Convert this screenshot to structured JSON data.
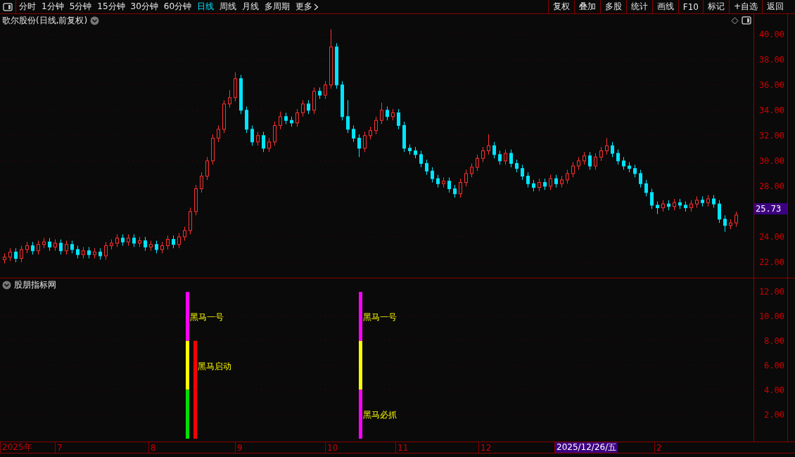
{
  "toolbar": {
    "periods": [
      {
        "label": "分时",
        "selected": false
      },
      {
        "label": "1分钟",
        "selected": false
      },
      {
        "label": "5分钟",
        "selected": false
      },
      {
        "label": "15分钟",
        "selected": false
      },
      {
        "label": "30分钟",
        "selected": false
      },
      {
        "label": "60分钟",
        "selected": false
      },
      {
        "label": "日线",
        "selected": true
      },
      {
        "label": "周线",
        "selected": false
      },
      {
        "label": "月线",
        "selected": false
      },
      {
        "label": "多周期",
        "selected": false
      }
    ],
    "more": "更多",
    "actions": [
      "复权",
      "叠加",
      "多股",
      "统计",
      "画线",
      "F10",
      "标记",
      "+自选",
      "返回"
    ]
  },
  "main_chart": {
    "title": "歌尔股份(日线,前复权)",
    "price_tag": "25.73",
    "chart_data": {
      "type": "candlestick",
      "ylim": [
        7.7,
        41.8
      ],
      "grid": true,
      "yticks": [
        {
          "value": 40,
          "label": "40.00"
        },
        {
          "value": 38,
          "label": "38.00"
        },
        {
          "value": 36,
          "label": "36.00"
        },
        {
          "value": 34,
          "label": "34.00"
        },
        {
          "value": 32,
          "label": "32.00"
        },
        {
          "value": 30,
          "label": "30.00"
        },
        {
          "value": 28,
          "label": "28.00"
        },
        {
          "value": 24,
          "label": "24.00"
        },
        {
          "value": 22,
          "label": "22.00"
        }
      ],
      "ohlc": [
        [
          22.2,
          22.7,
          21.9,
          22.4
        ],
        [
          22.4,
          23.1,
          22.1,
          22.8
        ],
        [
          22.8,
          23.1,
          22.0,
          22.3
        ],
        [
          22.3,
          23.3,
          22.0,
          23.0
        ],
        [
          23.0,
          23.6,
          22.7,
          23.3
        ],
        [
          23.3,
          23.6,
          22.6,
          22.9
        ],
        [
          22.9,
          23.7,
          22.6,
          23.4
        ],
        [
          23.4,
          23.9,
          23.1,
          23.6
        ],
        [
          23.6,
          23.9,
          22.9,
          23.2
        ],
        [
          23.2,
          23.8,
          22.9,
          23.5
        ],
        [
          23.5,
          23.8,
          22.6,
          22.9
        ],
        [
          22.9,
          23.7,
          22.6,
          23.4
        ],
        [
          23.4,
          23.7,
          22.7,
          23.0
        ],
        [
          23.0,
          23.3,
          22.3,
          22.6
        ],
        [
          22.6,
          23.2,
          22.3,
          22.9
        ],
        [
          22.9,
          23.2,
          22.3,
          22.6
        ],
        [
          22.6,
          23.1,
          22.3,
          22.8
        ],
        [
          22.8,
          23.1,
          22.2,
          22.5
        ],
        [
          22.5,
          23.6,
          22.2,
          23.3
        ],
        [
          23.3,
          23.8,
          23.0,
          23.5
        ],
        [
          23.5,
          24.2,
          23.2,
          23.9
        ],
        [
          23.9,
          24.2,
          23.3,
          23.6
        ],
        [
          23.6,
          24.2,
          23.3,
          23.9
        ],
        [
          23.9,
          24.2,
          23.2,
          23.5
        ],
        [
          23.5,
          24.0,
          23.2,
          23.7
        ],
        [
          23.7,
          24.0,
          22.9,
          23.2
        ],
        [
          23.2,
          23.7,
          22.9,
          23.4
        ],
        [
          23.4,
          23.7,
          22.7,
          23.0
        ],
        [
          23.0,
          23.6,
          22.7,
          23.3
        ],
        [
          23.3,
          24.1,
          23.0,
          23.8
        ],
        [
          23.8,
          24.1,
          23.1,
          23.4
        ],
        [
          23.4,
          24.3,
          23.1,
          24.0
        ],
        [
          24.0,
          24.8,
          23.7,
          24.5
        ],
        [
          24.5,
          26.3,
          24.2,
          26.0
        ],
        [
          26.0,
          28.1,
          25.7,
          27.8
        ],
        [
          27.8,
          29.1,
          27.5,
          28.8
        ],
        [
          28.8,
          30.3,
          28.5,
          30.0
        ],
        [
          30.0,
          32.1,
          29.7,
          31.8
        ],
        [
          31.8,
          32.8,
          31.5,
          32.5
        ],
        [
          32.5,
          34.8,
          32.2,
          34.5
        ],
        [
          34.5,
          35.6,
          34.2,
          35.0
        ],
        [
          35.0,
          37.0,
          34.7,
          36.5
        ],
        [
          36.5,
          36.8,
          33.7,
          34.0
        ],
        [
          34.0,
          34.3,
          32.2,
          32.5
        ],
        [
          32.5,
          32.8,
          31.2,
          31.5
        ],
        [
          31.5,
          32.3,
          31.2,
          32.0
        ],
        [
          32.0,
          32.3,
          30.7,
          31.0
        ],
        [
          31.0,
          31.8,
          30.7,
          31.5
        ],
        [
          31.5,
          33.1,
          31.2,
          32.8
        ],
        [
          32.8,
          33.9,
          32.5,
          33.5
        ],
        [
          33.5,
          33.8,
          32.9,
          33.2
        ],
        [
          33.2,
          33.5,
          32.7,
          33.0
        ],
        [
          33.0,
          34.1,
          32.7,
          33.8
        ],
        [
          33.8,
          34.8,
          33.5,
          34.5
        ],
        [
          34.5,
          34.8,
          33.7,
          34.0
        ],
        [
          34.0,
          35.8,
          33.7,
          35.5
        ],
        [
          35.5,
          35.8,
          34.9,
          35.2
        ],
        [
          35.2,
          36.3,
          34.9,
          36.0
        ],
        [
          36.0,
          40.4,
          35.7,
          39.0
        ],
        [
          39.0,
          39.3,
          35.7,
          36.0
        ],
        [
          36.0,
          36.3,
          33.2,
          33.5
        ],
        [
          33.5,
          34.8,
          32.2,
          32.5
        ],
        [
          32.5,
          32.8,
          31.5,
          31.8
        ],
        [
          31.8,
          32.1,
          30.3,
          31.0
        ],
        [
          31.0,
          32.3,
          30.7,
          32.0
        ],
        [
          32.0,
          32.7,
          31.7,
          32.4
        ],
        [
          32.4,
          33.5,
          32.1,
          33.2
        ],
        [
          33.2,
          34.6,
          32.9,
          34.0
        ],
        [
          34.0,
          34.3,
          33.2,
          33.5
        ],
        [
          33.5,
          34.1,
          33.2,
          33.8
        ],
        [
          33.8,
          34.1,
          32.5,
          32.8
        ],
        [
          32.8,
          33.1,
          30.7,
          31.0
        ],
        [
          31.0,
          31.3,
          30.5,
          30.8
        ],
        [
          30.8,
          31.1,
          30.2,
          30.5
        ],
        [
          30.5,
          30.8,
          29.5,
          29.8
        ],
        [
          29.8,
          30.1,
          28.9,
          29.2
        ],
        [
          29.2,
          29.5,
          28.3,
          28.6
        ],
        [
          28.6,
          28.9,
          27.9,
          28.2
        ],
        [
          28.2,
          28.7,
          27.9,
          28.4
        ],
        [
          28.4,
          28.7,
          27.5,
          27.8
        ],
        [
          27.8,
          28.1,
          27.1,
          27.4
        ],
        [
          27.4,
          28.6,
          27.1,
          28.3
        ],
        [
          28.3,
          29.3,
          28.0,
          29.0
        ],
        [
          29.0,
          29.8,
          28.7,
          29.5
        ],
        [
          29.5,
          30.5,
          29.2,
          30.2
        ],
        [
          30.2,
          31.1,
          29.9,
          30.8
        ],
        [
          30.8,
          32.1,
          30.5,
          31.2
        ],
        [
          31.2,
          31.5,
          30.2,
          30.5
        ],
        [
          30.5,
          30.8,
          29.7,
          30.0
        ],
        [
          30.0,
          30.9,
          29.7,
          30.6
        ],
        [
          30.6,
          30.9,
          29.5,
          29.8
        ],
        [
          29.8,
          30.1,
          29.1,
          29.4
        ],
        [
          29.4,
          29.7,
          28.5,
          28.8
        ],
        [
          28.8,
          29.1,
          27.9,
          28.2
        ],
        [
          28.2,
          28.5,
          27.6,
          27.9
        ],
        [
          27.9,
          28.6,
          27.6,
          28.3
        ],
        [
          28.3,
          28.6,
          27.7,
          28.0
        ],
        [
          28.0,
          28.9,
          27.7,
          28.6
        ],
        [
          28.6,
          28.9,
          27.9,
          28.2
        ],
        [
          28.2,
          28.8,
          27.9,
          28.5
        ],
        [
          28.5,
          29.3,
          28.2,
          29.0
        ],
        [
          29.0,
          29.9,
          28.7,
          29.6
        ],
        [
          29.6,
          30.3,
          29.3,
          30.0
        ],
        [
          30.0,
          30.7,
          29.7,
          30.4
        ],
        [
          30.4,
          30.7,
          29.3,
          29.6
        ],
        [
          29.6,
          30.6,
          29.3,
          30.3
        ],
        [
          30.3,
          31.1,
          30.0,
          30.8
        ],
        [
          30.8,
          31.8,
          30.5,
          31.2
        ],
        [
          31.2,
          31.5,
          30.3,
          30.6
        ],
        [
          30.6,
          30.9,
          29.7,
          30.0
        ],
        [
          30.0,
          30.3,
          29.3,
          29.6
        ],
        [
          29.6,
          29.9,
          29.1,
          29.4
        ],
        [
          29.4,
          29.7,
          28.7,
          29.0
        ],
        [
          29.0,
          29.3,
          27.9,
          28.2
        ],
        [
          28.2,
          28.5,
          27.2,
          27.5
        ],
        [
          27.5,
          27.8,
          26.2,
          26.5
        ],
        [
          26.5,
          26.8,
          25.8,
          26.3
        ],
        [
          26.3,
          26.9,
          26.0,
          26.6
        ],
        [
          26.6,
          26.9,
          26.1,
          26.4
        ],
        [
          26.4,
          27.0,
          26.1,
          26.7
        ],
        [
          26.7,
          27.0,
          26.2,
          26.5
        ],
        [
          26.5,
          26.8,
          26.0,
          26.3
        ],
        [
          26.3,
          26.9,
          26.0,
          26.6
        ],
        [
          26.6,
          27.2,
          26.3,
          26.9
        ],
        [
          26.9,
          27.2,
          26.4,
          26.7
        ],
        [
          26.7,
          27.3,
          26.4,
          27.0
        ],
        [
          27.0,
          27.3,
          26.3,
          26.6
        ],
        [
          26.6,
          26.9,
          25.1,
          25.4
        ],
        [
          25.4,
          25.7,
          24.4,
          24.9
        ],
        [
          24.9,
          25.4,
          24.6,
          25.1
        ],
        [
          25.1,
          26.0,
          24.8,
          25.73
        ]
      ]
    }
  },
  "indicator": {
    "title": "股朋指标网",
    "y_ticks": [
      "12.00",
      "10.00",
      "8.00",
      "6.00",
      "4.00",
      "2.00"
    ],
    "columns": [
      {
        "segments": [
          {
            "color": "#ff00ff",
            "label": "黑马一号"
          },
          {
            "color": "#ffff00"
          },
          {
            "color": "#00e000"
          }
        ]
      },
      {
        "segments": [
          {
            "color": "#ff0000",
            "label": "黑马启动"
          },
          {
            "color": "#ff0000"
          }
        ]
      },
      {
        "segments": [
          {
            "color": "#ff00ff",
            "label": "黑马一号"
          },
          {
            "color": "#ffff00"
          },
          {
            "color": "#ff00ff",
            "label": "黑马必抓"
          }
        ]
      }
    ]
  },
  "date_axis": [
    {
      "label": "2025年",
      "selected": false
    },
    {
      "label": "7",
      "selected": false
    },
    {
      "label": "8",
      "selected": false
    },
    {
      "label": "9",
      "selected": false
    },
    {
      "label": "10",
      "selected": false
    },
    {
      "label": "11",
      "selected": false
    },
    {
      "label": "12",
      "selected": false
    },
    {
      "label": "2025/12/26/五",
      "selected": true
    },
    {
      "label": "2",
      "selected": false
    }
  ]
}
